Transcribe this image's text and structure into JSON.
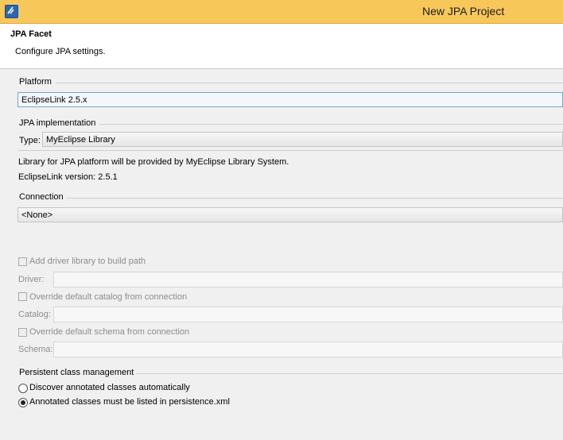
{
  "window": {
    "title": "New JPA Project",
    "icon": "myeclipse-icon"
  },
  "banner": {
    "title": "JPA Facet",
    "description": "Configure JPA settings."
  },
  "platform": {
    "label": "Platform",
    "selected": "EclipseLink 2.5.x"
  },
  "implementation": {
    "label": "JPA implementation",
    "type_label": "Type:",
    "type_selected": "MyEclipse Library",
    "info_line1": "Library for JPA platform will be provided by MyEclipse Library System.",
    "info_line2": "EclipseLink version: 2.5.1"
  },
  "connection": {
    "label": "Connection",
    "selected": "<None>",
    "add_driver_label": "Add driver library to build path",
    "driver_label": "Driver:",
    "override_catalog_label": "Override default catalog from connection",
    "catalog_label": "Catalog:",
    "override_schema_label": "Override default schema from connection",
    "schema_label": "Schema:"
  },
  "persistent": {
    "label": "Persistent class management",
    "option_discover": "Discover annotated classes automatically",
    "option_listed": "Annotated classes must be listed in persistence.xml",
    "selected": "option_listed"
  }
}
